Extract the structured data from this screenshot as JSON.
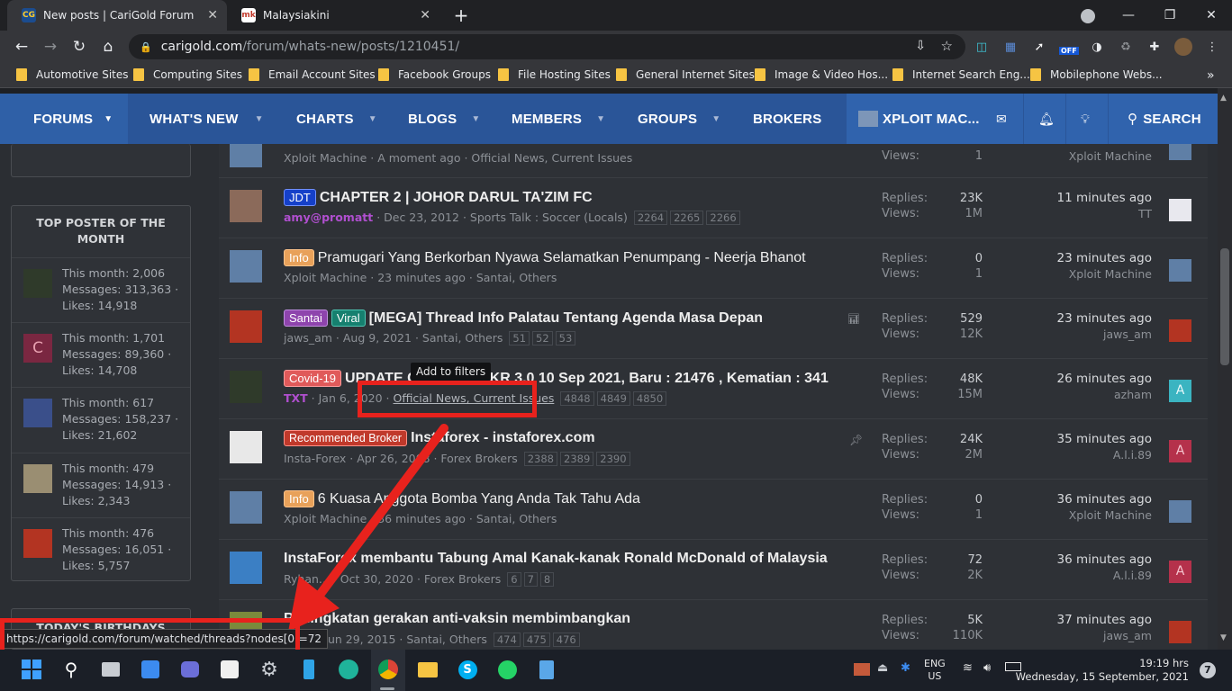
{
  "browser": {
    "tabs": [
      {
        "title": "New posts | CariGold Forum",
        "favicon": "CG"
      },
      {
        "title": "Malaysiakini",
        "favicon": "mk"
      }
    ],
    "url_host": "carigold.com",
    "url_path": "/forum/whats-new/posts/1210451/",
    "bookmarks": [
      "Automotive Sites",
      "Computing Sites",
      "Email Account Sites",
      "Facebook Groups",
      "File Hosting Sites",
      "General Internet Sites",
      "Image & Video Hos...",
      "Internet Search Eng...",
      "Mobilephone Webs..."
    ],
    "ext_badge": "OFF"
  },
  "nav": {
    "forums": "FORUMS",
    "whats_new": "WHAT'S NEW",
    "charts": "CHARTS",
    "blogs": "BLOGS",
    "members": "MEMBERS",
    "groups": "GROUPS",
    "brokers": "BROKERS",
    "user": "XPLOIT MAC...",
    "search": "SEARCH"
  },
  "sidebar": {
    "top_poster_title": "TOP POSTER OF THE MONTH",
    "posters": [
      {
        "line1": "This month: 2,006",
        "line2": "Messages: 313,363 ·",
        "line3": "Likes: 14,918"
      },
      {
        "line1": "This month: 1,701",
        "line2": "Messages: 89,360 ·",
        "line3": "Likes: 14,708",
        "initial": "C"
      },
      {
        "line1": "This month: 617",
        "line2": "Messages: 158,237 ·",
        "line3": "Likes: 21,602"
      },
      {
        "line1": "This month: 479",
        "line2": "Messages: 14,913 ·",
        "line3": "Likes: 2,343"
      },
      {
        "line1": "This month: 476",
        "line2": "Messages: 16,051 ·",
        "line3": "Likes: 5,757"
      }
    ],
    "birthdays_title": "TODAY'S BIRTHDAYS"
  },
  "threads": [
    {
      "meta": "Xploit Machine · A moment ago · Official News, Current Issues",
      "views_label": "Views:",
      "views": "1",
      "last_user": "Xploit Machine"
    },
    {
      "labels": [
        {
          "text": "JDT",
          "style": "jdt"
        }
      ],
      "title": "CHAPTER 2 | JOHOR DARUL TA'ZIM FC",
      "author": "amy@promatt",
      "meta": " · Dec 23, 2012 · Sports Talk : Soccer (Locals)",
      "pages": [
        "2264",
        "2265",
        "2266"
      ],
      "replies": "23K",
      "views": "1M",
      "last_time": "11 minutes ago",
      "last_user": "TT"
    },
    {
      "labels": [
        {
          "text": "Info",
          "style": "info"
        }
      ],
      "title": "Pramugari Yang Berkorban Nyawa Selamatkan Penumpang - Neerja Bhanot",
      "meta": "Xploit Machine · 23 minutes ago · Santai, Others",
      "replies": "0",
      "views": "1",
      "last_time": "23 minutes ago",
      "last_user": "Xploit Machine"
    },
    {
      "labels": [
        {
          "text": "Santai",
          "style": "santai"
        },
        {
          "text": "Viral",
          "style": "viral"
        }
      ],
      "title": "[MEGA] Thread Info Palatau Tentang Agenda Masa Depan",
      "meta": "jaws_am · Aug 9, 2021 · Santai, Others",
      "pages": [
        "51",
        "52",
        "53"
      ],
      "replies": "529",
      "views": "12K",
      "last_time": "23 minutes ago",
      "last_user": "jaws_am"
    },
    {
      "labels": [
        {
          "text": "Covid-19",
          "style": "covid"
        }
      ],
      "title": "UPDATE COVID-19 MKR 3.0 10 Sep 2021, Baru : 21476 , Kematian : 341",
      "author": "TXT",
      "meta_pre": " · Jan 6, 2020 · ",
      "meta_link": "Official News, Current Issues",
      "pages": [
        "4848",
        "4849",
        "4850"
      ],
      "replies": "48K",
      "views": "15M",
      "last_time": "26 minutes ago",
      "last_user": "azham",
      "last_initial": "A"
    },
    {
      "labels": [
        {
          "text": "Recommended Broker",
          "style": "broker"
        }
      ],
      "title": "Instaforex - instaforex.com",
      "meta": "Insta-Forex · Apr 26, 2008 · Forex Brokers",
      "pages": [
        "2388",
        "2389",
        "2390"
      ],
      "replies": "24K",
      "views": "2M",
      "last_time": "35 minutes ago",
      "last_user": "A.l.i.89",
      "last_initial": "A"
    },
    {
      "labels": [
        {
          "text": "Info",
          "style": "info"
        }
      ],
      "title": "6 Kuasa Anggota Bomba Yang Anda Tak Tahu Ada",
      "meta": "Xploit Machine · 36 minutes ago · Santai, Others",
      "replies": "0",
      "views": "1",
      "last_time": "36 minutes ago",
      "last_user": "Xploit Machine"
    },
    {
      "title": "InstaForex membantu Tabung Amal Kanak-kanak Ronald McDonald of Malaysia",
      "meta": "Ryhan... · Oct 30, 2020 · Forex Brokers",
      "pages": [
        "6",
        "7",
        "8"
      ],
      "replies": "72",
      "views": "2K",
      "last_time": "36 minutes ago",
      "last_user": "A.l.i.89",
      "last_initial": "A"
    },
    {
      "title": "Peningkatan gerakan anti-vaksin membimbangkan",
      "meta": "...turi · Jun 29, 2015 · Santai, Others",
      "pages": [
        "474",
        "475",
        "476"
      ],
      "replies": "5K",
      "views": "110K",
      "last_time": "37 minutes ago",
      "last_user": "jaws_am"
    }
  ],
  "labels_common": {
    "replies": "Replies:",
    "views": "Views:"
  },
  "tooltip": "Add to filters",
  "status_url": "https://carigold.com/forum/watched/threads?nodes[0]=72",
  "taskbar": {
    "lang1": "ENG",
    "lang2": "US",
    "time": "19:19 hrs",
    "date": "Wednesday, 15 September, 2021",
    "notif": "7"
  },
  "colors": {
    "nav": "#2a5598",
    "annotation": "#e8221d"
  }
}
